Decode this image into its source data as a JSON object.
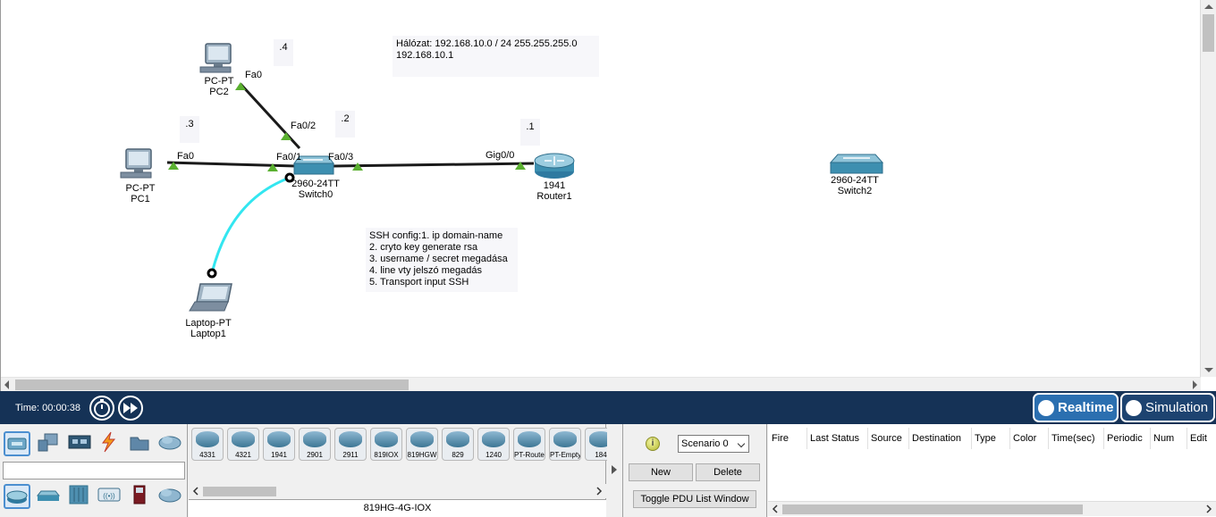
{
  "topology": {
    "devices": {
      "pc2": {
        "type": "PC-PT",
        "name": "PC2"
      },
      "pc1": {
        "type": "PC-PT",
        "name": "PC1"
      },
      "laptop1": {
        "type": "Laptop-PT",
        "name": "Laptop1"
      },
      "switch0": {
        "type": "2960-24TT",
        "name": "Switch0"
      },
      "router1": {
        "type": "1941",
        "name": "Router1"
      },
      "switch2": {
        "type": "2960-24TT",
        "name": "Switch2"
      }
    },
    "ports": {
      "pc2_fa0": "Fa0",
      "pc1_fa0": "Fa0",
      "sw0_fa02": "Fa0/2",
      "sw0_fa01": "Fa0/1",
      "sw0_fa03": "Fa0/3",
      "r1_gig00": "Gig0/0"
    },
    "ip_notes": {
      "pc2": ".4",
      "pc1": ".3",
      "switch0": ".2",
      "router1": ".1"
    },
    "network_note": "Hálózat: 192.168.10.0 / 24 255.255.255.0\n192.168.10.1",
    "ssh_note": "SSH config:1. ip domain-name\n2. cryto key generate rsa\n3. username / secret megadása\n4. line vty jelszó megadás\n5. Transport input SSH",
    "colors": {
      "link": "#1a1a1a",
      "console_cable": "#33e6f0",
      "port_up": "#5ab030"
    }
  },
  "timebar": {
    "time_label": "Time: 00:00:38",
    "realtime_label": "Realtime",
    "simulation_label": "Simulation",
    "realtime_active": true
  },
  "device_palette": {
    "categories_top": [
      "network-devices-icon",
      "end-devices-icon",
      "components-icon",
      "connections-icon",
      "miscellaneous-icon",
      "multiuser-icon"
    ],
    "categories_bottom": [
      "routers-icon",
      "switches-icon",
      "hubs-icon",
      "wireless-icon",
      "security-icon",
      "wan-emulation-icon"
    ],
    "models": [
      "4331",
      "4321",
      "1941",
      "2901",
      "2911",
      "819IOX",
      "819HGW",
      "829",
      "1240",
      "PT-Router",
      "PT-Empty",
      "184"
    ],
    "selected_model": "819HG-4G-IOX"
  },
  "scenario": {
    "selected": "Scenario 0",
    "new_label": "New",
    "delete_label": "Delete",
    "toggle_label": "Toggle PDU List Window"
  },
  "pdu_table": {
    "columns": [
      "Fire",
      "Last Status",
      "Source",
      "Destination",
      "Type",
      "Color",
      "Time(sec)",
      "Periodic",
      "Num",
      "Edit"
    ]
  }
}
